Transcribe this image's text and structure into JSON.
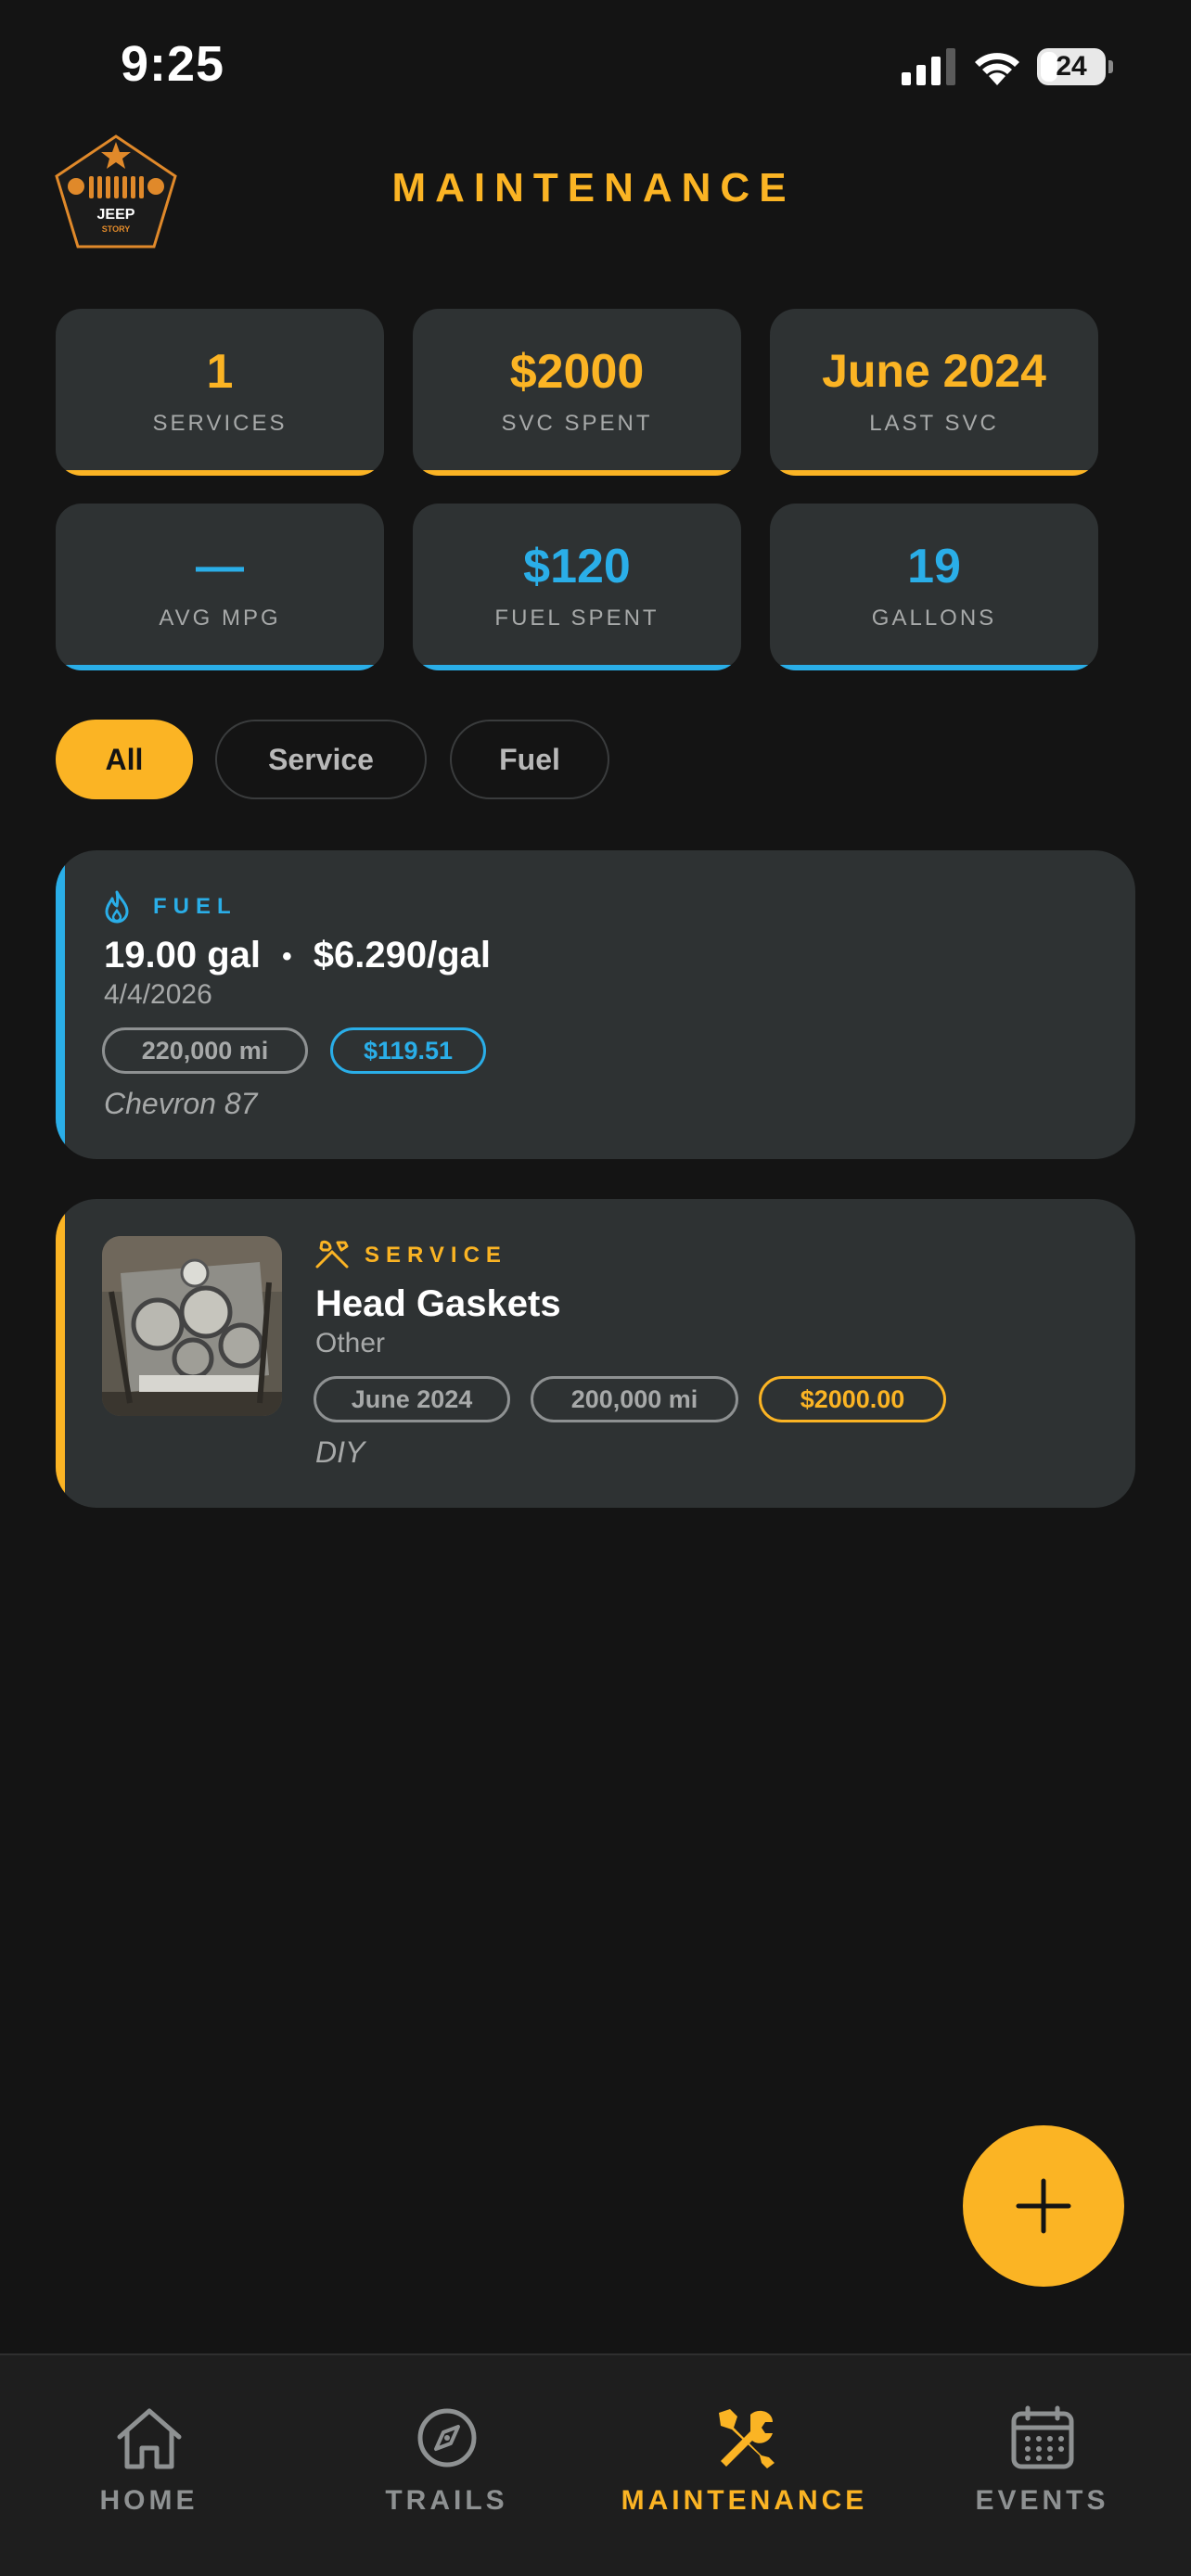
{
  "status_bar": {
    "time": "9:25",
    "battery": "24"
  },
  "header": {
    "title": "MAINTENANCE",
    "logo": {
      "line1": "JEEP",
      "line2": "STORY"
    }
  },
  "stats": [
    {
      "value": "1",
      "label": "SERVICES"
    },
    {
      "value": "$2000",
      "label": "SVC SPENT"
    },
    {
      "value": "June 2024",
      "label": "LAST SVC"
    },
    {
      "value": "—",
      "label": "AVG MPG"
    },
    {
      "value": "$120",
      "label": "FUEL SPENT"
    },
    {
      "value": "19",
      "label": "GALLONS"
    }
  ],
  "filters": [
    {
      "label": "All",
      "active": true
    },
    {
      "label": "Service",
      "active": false
    },
    {
      "label": "Fuel",
      "active": false
    }
  ],
  "entries": [
    {
      "type": "FUEL",
      "title_gallons": "19.00 gal",
      "title_separator": "•",
      "title_price": "$6.290/gal",
      "date": "4/4/2026",
      "mileage": "220,000 mi",
      "cost": "$119.51",
      "note": "Chevron 87"
    },
    {
      "type": "SERVICE",
      "title": "Head Gaskets",
      "category": "Other",
      "date": "June 2024",
      "mileage": "200,000 mi",
      "cost": "$2000.00",
      "note": "DIY"
    }
  ],
  "tabs": [
    {
      "label": "HOME",
      "icon": "home-icon"
    },
    {
      "label": "TRAILS",
      "icon": "compass-icon"
    },
    {
      "label": "MAINTENANCE",
      "icon": "wrench-screwdriver-icon",
      "active": true
    },
    {
      "label": "EVENTS",
      "icon": "calendar-icon"
    }
  ],
  "colors": {
    "background": "#141414",
    "card": "#2e3233",
    "accent_service": "#fbb424",
    "accent_fuel": "#2aaee8",
    "muted_text": "#a7a9a9"
  }
}
